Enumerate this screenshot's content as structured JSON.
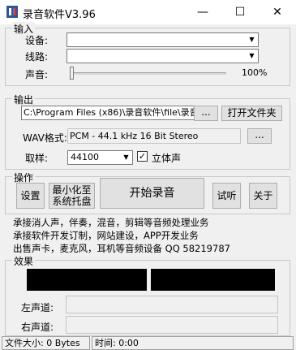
{
  "window": {
    "title": "录音软件V3.96",
    "minimize": "—",
    "maximize": "☐",
    "close": "✕"
  },
  "input_group": {
    "label": "输入",
    "device_label": "设备:",
    "device_value": "",
    "line_label": "线路:",
    "line_value": "",
    "volume_label": "声音:",
    "volume_percent": "100%",
    "volume_level": 0
  },
  "output_group": {
    "label": "输出",
    "path_value": "C:\\Program Files (x86)\\录音软件\\file\\录音",
    "browse_label": "...",
    "open_folder_label": "打开文件夹",
    "wav_label": "WAV格式:",
    "wav_value": "PCM - 44.1 kHz 16 Bit Stereo",
    "wav_browse_label": "...",
    "sample_label": "取样:",
    "sample_value": "44100",
    "stereo_label": "立体声",
    "stereo_checked": true
  },
  "actions_group": {
    "label": "操作",
    "settings_label": "设置",
    "minimize_tray_line1": "最小化至",
    "minimize_tray_line2": "系统托盘",
    "start_label": "开始录音",
    "listen_label": "试听",
    "about_label": "关于"
  },
  "info": {
    "line1": "承接消人声，伴奏，混音，剪辑等音频处理业务",
    "line2": "承接软件开发订制，网站建设，APP开发业务",
    "line3": "出售声卡，麦克风，耳机等音频设备 QQ 58219787"
  },
  "effects_group": {
    "label": "效果",
    "left_channel_label": "左声道:",
    "right_channel_label": "右声道:"
  },
  "status": {
    "file_size": "文件大小: 0 Bytes",
    "time": "时间: 0:00"
  }
}
